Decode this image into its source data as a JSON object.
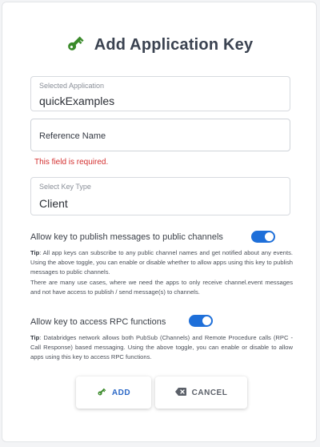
{
  "dialog": {
    "title": "Add Application Key",
    "key_icon": "key-icon"
  },
  "fields": {
    "application": {
      "label": "Selected Application",
      "value": "quickExamples"
    },
    "reference": {
      "placeholder": "Reference Name",
      "value": "",
      "error": "This field is required."
    },
    "key_type": {
      "label": "Select Key Type",
      "value": "Client"
    }
  },
  "toggles": {
    "publish": {
      "label": "Allow key to publish messages to public channels",
      "enabled": true,
      "tip_prefix": "Tip",
      "tip_text": ": All app keys can subscribe to any public channel names and get notified about any events. Using the above toggle, you can enable or disable whether to allow apps using this key to publish messages to public channels.",
      "tip_text_2": "There are many use cases, where we need the apps to only receive channel.event messages and not have access to publish / send message(s) to channels."
    },
    "rpc": {
      "label": "Allow key to access RPC functions",
      "enabled": true,
      "tip_prefix": "Tip",
      "tip_text": ": Databridges network allows both PubSub (Channels) and Remote Procedure calls (RPC - Call Response) based messaging. Using the above toggle, you can enable or disable to allow apps using this key to access RPC functions."
    }
  },
  "buttons": {
    "add": {
      "label": "ADD",
      "icon": "key-icon"
    },
    "cancel": {
      "label": "CANCEL",
      "icon": "backspace-icon"
    }
  },
  "colors": {
    "accent": "#1e6fd9",
    "key_green": "#3a8a2a",
    "error": "#d32f2f"
  }
}
